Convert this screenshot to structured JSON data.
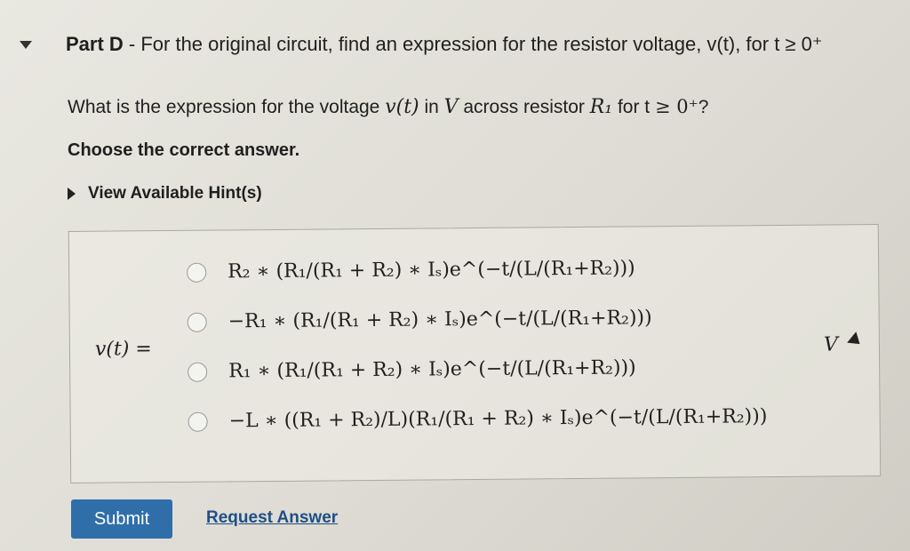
{
  "part": {
    "label": "Part D",
    "title": " - For the original circuit, find an expression for the resistor voltage, v(t), for t ≥ 0⁺"
  },
  "question": {
    "prefix": "What is the expression for the voltage ",
    "var": "v(t)",
    "in": " in ",
    "unit": "V",
    "across": " across resistor ",
    "resistor": "R₁",
    "for": " for t ",
    "condition": "≥ 0⁺",
    "end": "?"
  },
  "instruction": "Choose the correct answer.",
  "hint_link": "View Available Hint(s)",
  "answer": {
    "lhs": "v(t) =",
    "unit": "V",
    "options": [
      "R₂ ∗ (R₁/(R₁ + R₂) ∗ Iₛ)e^(−t/(L/(R₁+R₂)))",
      "−R₁ ∗ (R₁/(R₁ + R₂) ∗ Iₛ)e^(−t/(L/(R₁+R₂)))",
      "R₁ ∗ (R₁/(R₁ + R₂) ∗ Iₛ)e^(−t/(L/(R₁+R₂)))",
      "−L ∗ ((R₁ + R₂)/L)(R₁/(R₁ + R₂) ∗ Iₛ)e^(−t/(L/(R₁+R₂)))"
    ]
  },
  "buttons": {
    "submit": "Submit",
    "request": "Request Answer"
  }
}
